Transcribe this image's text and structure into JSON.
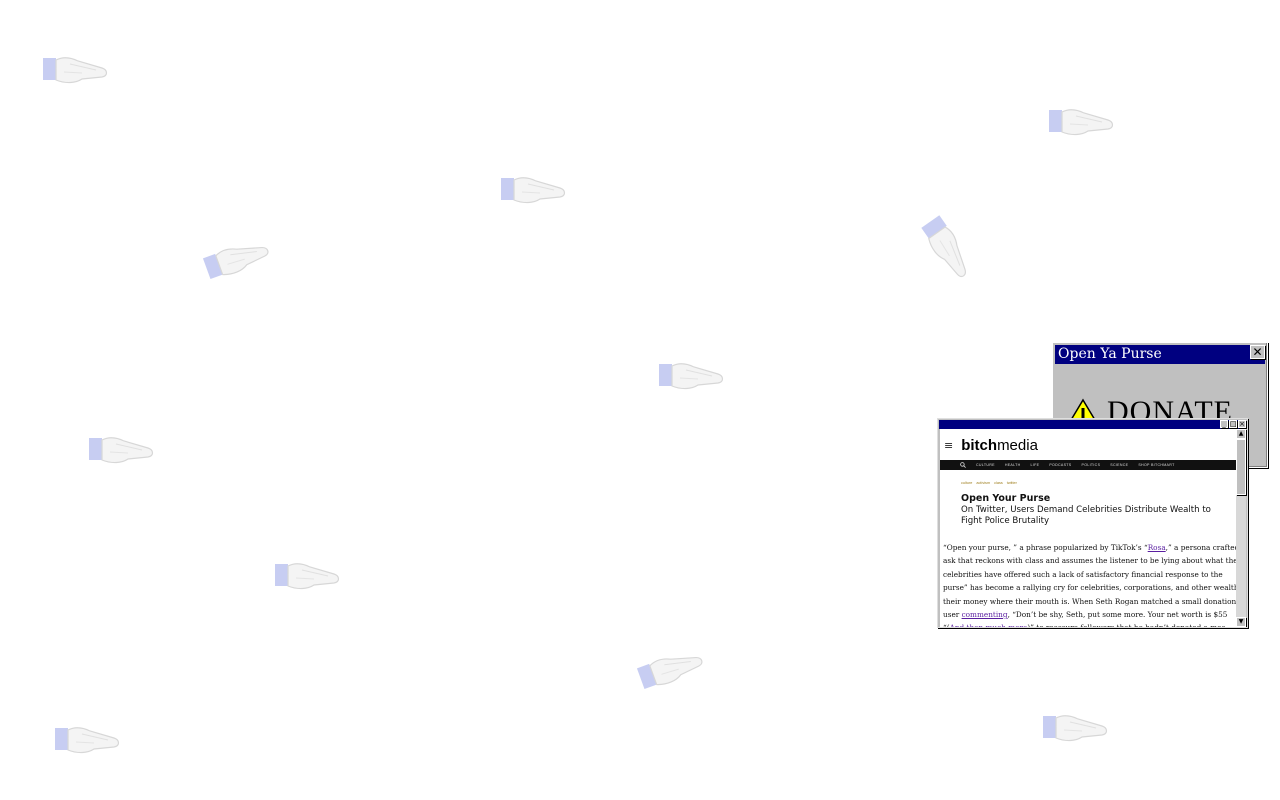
{
  "background": {
    "icon": "pointing-hand-icon",
    "color": "#ffffff"
  },
  "purse_window": {
    "title": "Open Ya Purse",
    "close_glyph": "✕",
    "icon": "warning-icon",
    "message": "DONATE"
  },
  "article_window": {
    "site": {
      "logo_bold": "bitch",
      "logo_light": "media",
      "menu_icon": "≡",
      "nav": [
        "CULTURE",
        "HEALTH",
        "LIFE",
        "PODCASTS",
        "POLITICS",
        "SCIENCE",
        "SHOP BITCHMART"
      ],
      "tags": [
        "culture",
        "activism",
        "class",
        "twitter"
      ]
    },
    "article": {
      "title": "Open Your Purse",
      "subtitle": "On Twitter, Users Demand Celebrities Distribute Wealth to Fight Police Brutality",
      "lines": [
        {
          "pre": "“Open your purse, ” a phrase popularized by TikTok’s “",
          "link": "Rosa",
          "post": ",” a persona crafted"
        },
        {
          "pre": "ask that reckons with class and assumes the listener to be lying about what they",
          "link": "",
          "post": ""
        },
        {
          "pre": "celebrities have offered such a lack of satisfactory financial response to the",
          "link": "",
          "post": ""
        },
        {
          "pre": "purse” has become a rallying cry for celebrities, corporations, and other wealthy",
          "link": "",
          "post": ""
        },
        {
          "pre": "their money where their mouth is. When Seth Rogan matched a small donation",
          "link": "",
          "post": ""
        },
        {
          "pre": "user ",
          "link": "commenting",
          "post": ", “Don’t be shy, Seth, put some more. Your net worth is $55"
        },
        {
          "pre": "“(",
          "link": "And then much more",
          "post": ")” to reassure followers that he hadn’t donated a mea"
        }
      ]
    },
    "link_color": "#5a1fa0"
  }
}
